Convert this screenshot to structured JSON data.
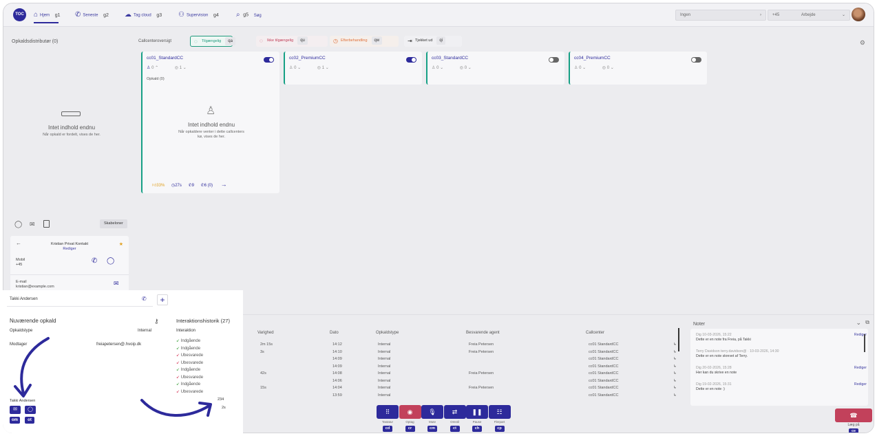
{
  "topbar": {
    "logo_text": "TOC",
    "nav": [
      {
        "label": "Hjem",
        "key": "g1",
        "icon": "home-icon"
      },
      {
        "label": "Seneste",
        "key": "g2",
        "icon": "phone-icon"
      },
      {
        "label": "Tag cloud",
        "key": "g3",
        "icon": "cloud-icon"
      },
      {
        "label": "Supervision",
        "key": "g4",
        "icon": "supervision-icon"
      },
      {
        "label": "Søg",
        "key": "g5",
        "icon": "search-icon"
      }
    ],
    "field_ingen": "Ingen",
    "phone_prefix": "+45",
    "status": "Arbejde"
  },
  "distributor": {
    "title": "Opkaldsdistributør (0)",
    "empty_title": "Intet indhold endnu",
    "empty_sub": "Når opkald er fordelt, vises de her."
  },
  "callcenter_overview": {
    "label": "Callcenteroversigt",
    "buttons": [
      {
        "label": "Tilgængelig",
        "key": "qa",
        "color": "#1f9a7c"
      },
      {
        "label": "Ikke tilgængelig",
        "key": "qu",
        "color": "#c2415b"
      },
      {
        "label": "Efterbehandling",
        "key": "qw",
        "color": "#e0713a"
      },
      {
        "label": "Tjekket ud",
        "key": "qi",
        "color": "#333333"
      }
    ],
    "centers": [
      {
        "name": "cc01_StandardCC",
        "agents": "0",
        "waiting": "1",
        "on": true
      },
      {
        "name": "cc02_PremiumCC",
        "agents": "0",
        "waiting": "1",
        "on": true
      },
      {
        "name": "cc03_StandardCC",
        "agents": "0",
        "waiting": "0",
        "on": false
      },
      {
        "name": "cc04_PremiumCC",
        "agents": "0",
        "waiting": "0",
        "on": false
      }
    ],
    "calls_label": "Opkald (0)",
    "cc_empty_title": "Intet indhold endnu",
    "cc_empty_sub": "Når opkaldere venter i dette callcenters kø, vises de her.",
    "stats": {
      "sla": "33%",
      "time": "27s",
      "calls": "9",
      "missed": "6 (0)"
    }
  },
  "contacts": {
    "templates_label": "Skabeloner",
    "contact_name": "Kristian Privat Kontakt",
    "edit_label": "Rediger",
    "mobile_label": "Mobil",
    "mobile_value": "+45",
    "email_label": "E-mail",
    "email_value": "kristian@example.com"
  },
  "history": {
    "columns": [
      "Varighed",
      "Dato",
      "Opkaldstype",
      "Besvarende agent",
      "Callcenter"
    ],
    "rows": [
      {
        "duration": "2m 15s",
        "date": "14:12",
        "type": "Internal",
        "agent": "Freia Petersen",
        "cc": "cc01 StandardCC"
      },
      {
        "duration": "3s",
        "date": "14:10",
        "type": "Internal",
        "agent": "Freia Petersen",
        "cc": "cc01 StandardCC"
      },
      {
        "duration": "",
        "date": "14:09",
        "type": "Internal",
        "agent": "",
        "cc": "cc01 StandardCC"
      },
      {
        "duration": "",
        "date": "14:09",
        "type": "Internal",
        "agent": "",
        "cc": "cc01 StandardCC"
      },
      {
        "duration": "42s",
        "date": "14:08",
        "type": "Internal",
        "agent": "Freia Petersen",
        "cc": "cc01 StandardCC"
      },
      {
        "duration": "",
        "date": "14:06",
        "type": "Internal",
        "agent": "",
        "cc": "cc01 StandardCC"
      },
      {
        "duration": "15s",
        "date": "14:04",
        "type": "Internal",
        "agent": "Freia Petersen",
        "cc": "cc01 StandardCC"
      },
      {
        "duration": "",
        "date": "13:59",
        "type": "Internal",
        "agent": "",
        "cc": "cc01 StandardCC"
      }
    ]
  },
  "controls": [
    {
      "label": "Tastatur",
      "key": "cd",
      "icon": "keypad-icon"
    },
    {
      "label": "Optag",
      "key": "cr",
      "icon": "record-icon"
    },
    {
      "label": "Mute",
      "key": "cm",
      "icon": "mic-icon"
    },
    {
      "label": "Omstil",
      "key": "ct",
      "icon": "transfer-icon"
    },
    {
      "label": "Pause",
      "key": "ch",
      "icon": "pause-icon"
    },
    {
      "label": "Flerpart",
      "key": "cp",
      "icon": "conference-icon"
    }
  ],
  "hangup": {
    "label": "Læg på",
    "key": "ce"
  },
  "notes": {
    "title": "Noter",
    "items": [
      {
        "meta": "Dig 10-03-2026, 15:22",
        "text": "Dette er en note fra Freia, på Takki",
        "edit": "Rediger"
      },
      {
        "meta": "Terry Davidson terry.davidson@ · 10-03-2026, 14:30",
        "text": "Dette er en note skrevet af Terry.",
        "edit": ""
      },
      {
        "meta": "Dig 20-02-2026, 15:28",
        "text": "Her kan du skrive en note",
        "edit": "Rediger"
      },
      {
        "meta": "Dig 19-02-2026, 15:31",
        "text": "Dette er en note :)",
        "edit": "Rediger"
      }
    ]
  },
  "overlay": {
    "tab_name": "Takki Andersen",
    "current_call_title": "Nuværende opkald",
    "call_type_label": "Opkaldstype",
    "call_type_value": "Internal",
    "receiver_label": "Modtager",
    "receiver_value": "freiapetersen@.hvoip.dk",
    "history_title": "Interaktionshistorik (27)",
    "interaction_label": "Interaktion",
    "interactions": [
      {
        "label": "Indgående",
        "kind": "in"
      },
      {
        "label": "Indgående",
        "kind": "in"
      },
      {
        "label": "Ubesvarede",
        "kind": "miss"
      },
      {
        "label": "Ubesvarede",
        "kind": "miss"
      },
      {
        "label": "Indgående",
        "kind": "in"
      },
      {
        "label": "Ubesvarede",
        "kind": "miss"
      },
      {
        "label": "Indgående",
        "kind": "in"
      },
      {
        "label": "Ubesvarede",
        "kind": "miss"
      }
    ],
    "side_value_1": "234",
    "side_value_2": "2s",
    "person_name": "Takki Andersen",
    "keys": [
      "om",
      "ot"
    ]
  }
}
